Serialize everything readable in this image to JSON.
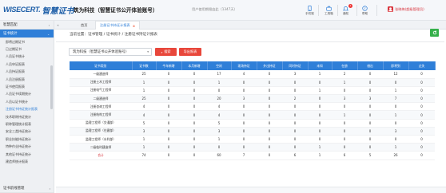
{
  "header": {
    "logo_mark": "WISECERT.",
    "logo_cn": "智慧证书",
    "company": "筑为科技（智慧证书公开体验账号）",
    "usage": "用户使用期限由此（1347天）",
    "items": [
      {
        "label": "手机端",
        "icon": "mobile-icon"
      },
      {
        "label": "工具箱",
        "icon": "toolbox-icon"
      },
      {
        "label": "通知",
        "icon": "bell-icon",
        "badge": "1"
      },
      {
        "label": "帮助",
        "icon": "help-icon"
      }
    ],
    "user_name": "张晓梅(超级管理员)"
  },
  "sidebar": {
    "groups": [
      {
        "label": "智慧匹配",
        "expanded": false
      },
      {
        "label": "证书统计",
        "expanded": true,
        "active": true
      }
    ],
    "items": [
      "即将过期证书",
      "已过期证书",
      "人员证书统计",
      "人员申证报表",
      "人员持证报表",
      "人员注册报表",
      "证书使用报表",
      "人员证书续期统计",
      "人员以证书统计",
      "注册证书持证统计报表",
      "技术职称持证统计",
      "职称管理统计报表",
      "安全三类持证统计",
      "职业技能持证统计",
      "特种作业持证统计",
      "其他证书持证统计",
      "建造师统计报表"
    ],
    "selected_index": 9,
    "footer_group": "证书前线管理"
  },
  "tabs": {
    "home": "首页",
    "current": "注册证书持证计报表"
  },
  "breadcrumb": "当前位置：证书管理 / 证书统计 / 注册证书持证计报表",
  "filter": {
    "value": "筑为科技（智慧证书公开体验账号）",
    "search_label": "搜索",
    "export_label": "导出报表"
  },
  "table": {
    "headers": [
      "证书类别",
      "证书数",
      "今年新增",
      "本月新增",
      "空闲",
      "现场持证",
      "外出持证",
      "同时持证",
      "未知",
      "在册",
      "借出",
      "即将到",
      "过失"
    ],
    "rows": [
      [
        "一级建造师",
        "25",
        "0",
        "0",
        "17",
        "4",
        "0",
        "3",
        "1",
        "2",
        "0",
        "12",
        "0"
      ],
      [
        "注册土木工程师",
        "1",
        "0",
        "0",
        "1",
        "0",
        "0",
        "0",
        "0",
        "1",
        "0",
        "0",
        "0"
      ],
      [
        "注册电气工程师",
        "1",
        "0",
        "0",
        "0",
        "0",
        "0",
        "0",
        "1",
        "0",
        "0",
        "1",
        "0"
      ],
      [
        "二级建造师",
        "25",
        "0",
        "0",
        "20",
        "3",
        "0",
        "2",
        "0",
        "3",
        "3",
        "7",
        "0"
      ],
      [
        "注册咨询工程师",
        "4",
        "0",
        "0",
        "4",
        "0",
        "0",
        "0",
        "0",
        "0",
        "0",
        "0",
        "0"
      ],
      [
        "注册结构工程师",
        "4",
        "0",
        "0",
        "4",
        "0",
        "0",
        "0",
        "0",
        "1",
        "0",
        "1",
        "0"
      ],
      [
        "监理工程师（交通部）",
        "5",
        "0",
        "0",
        "5",
        "0",
        "0",
        "0",
        "0",
        "0",
        "0",
        "0",
        "0"
      ],
      [
        "监理工程师（住建部）",
        "3",
        "0",
        "0",
        "3",
        "0",
        "0",
        "0",
        "0",
        "0",
        "0",
        "3",
        "0"
      ],
      [
        "监理工程师（水利部）",
        "1",
        "0",
        "0",
        "1",
        "0",
        "0",
        "0",
        "0",
        "0",
        "0",
        "0",
        "0"
      ],
      [
        "二级临时建造师",
        "1",
        "0",
        "0",
        "0",
        "0",
        "0",
        "0",
        "1",
        "0",
        "0",
        "1",
        "0"
      ],
      [
        "合计",
        "74",
        "0",
        "0",
        "60",
        "7",
        "0",
        "6",
        "1",
        "6",
        "5",
        "26",
        "0"
      ]
    ]
  },
  "colors": {
    "accent": "#2f7fd8",
    "danger": "#e8473b",
    "success": "#35b04a"
  }
}
